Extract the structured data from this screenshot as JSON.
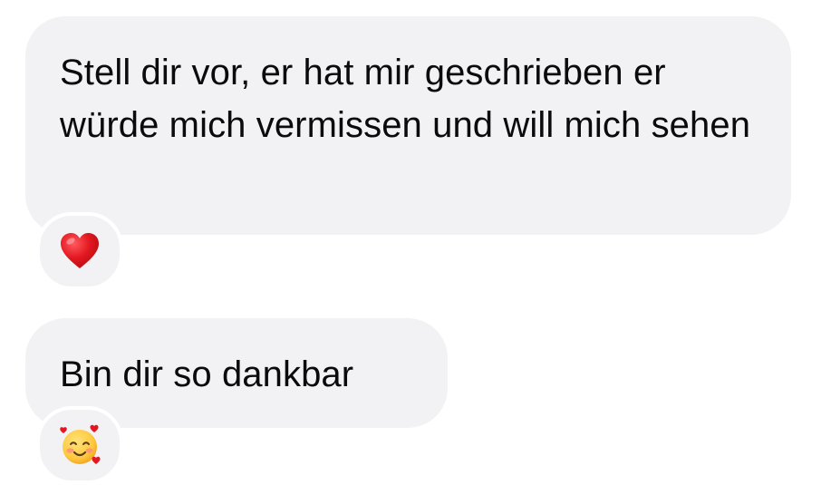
{
  "messages": [
    {
      "text": "Stell dir vor, er hat mir geschrieben er würde mich vermissen und will mich sehen",
      "reaction": "red-heart-icon"
    },
    {
      "text": "Bin dir so dankbar",
      "reaction": "smiling-face-with-hearts-icon"
    }
  ],
  "colors": {
    "bubble": "#f2f2f5",
    "text": "#0b0b0d",
    "heart": "#e3171f",
    "face": "#ffc83d",
    "blush": "#ff8a80"
  }
}
